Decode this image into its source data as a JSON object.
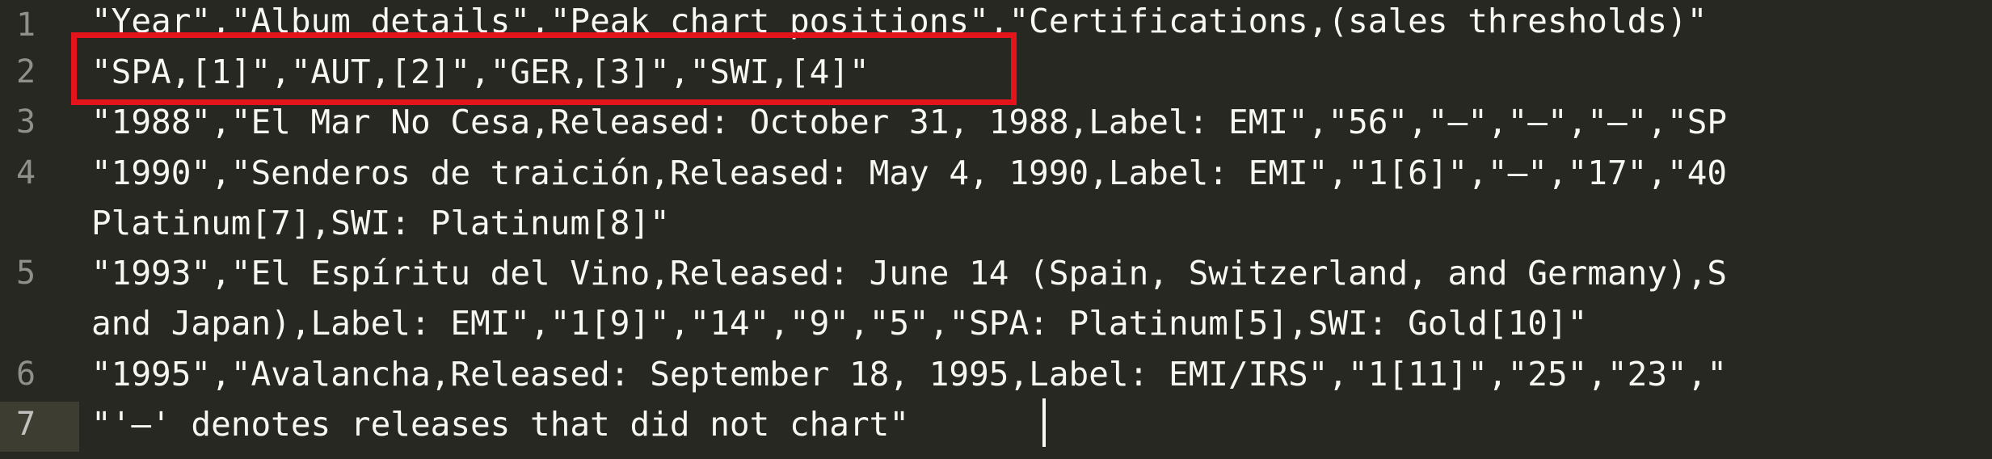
{
  "editor": {
    "line_numbers": [
      "1",
      "2",
      "3",
      "4",
      "",
      "5",
      "",
      "6",
      "7"
    ],
    "lines": [
      "\"Year\",\"Album details\",\"Peak chart positions\",\"Certifications,(sales thresholds)\"",
      "\"SPA,[1]\",\"AUT,[2]\",\"GER,[3]\",\"SWI,[4]\"",
      "\"1988\",\"El Mar No Cesa,Released: October 31, 1988,Label: EMI\",\"56\",\"—\",\"—\",\"—\",\"SP",
      "\"1990\",\"Senderos de traición,Released: May 4, 1990,Label: EMI\",\"1[6]\",\"—\",\"17\",\"40",
      "Platinum[7],SWI: Platinum[8]\"",
      "\"1993\",\"El Espíritu del Vino,Released: June 14 (Spain, Switzerland, and Germany),S",
      "and Japan),Label: EMI\",\"1[9]\",\"14\",\"9\",\"5\",\"SPA: Platinum[5],SWI: Gold[10]\"",
      "\"1995\",\"Avalancha,Released: September 18, 1995,Label: EMI/IRS\",\"1[11]\",\"25\",\"23\",\"",
      "\"'—' denotes releases that did not chart\""
    ],
    "active_line": "7",
    "colors": {
      "background": "#272822",
      "text": "#f8f8f2",
      "gutter_text": "#8f908a",
      "active_line": "#3e3d32",
      "highlight_border": "#e3141b"
    }
  }
}
